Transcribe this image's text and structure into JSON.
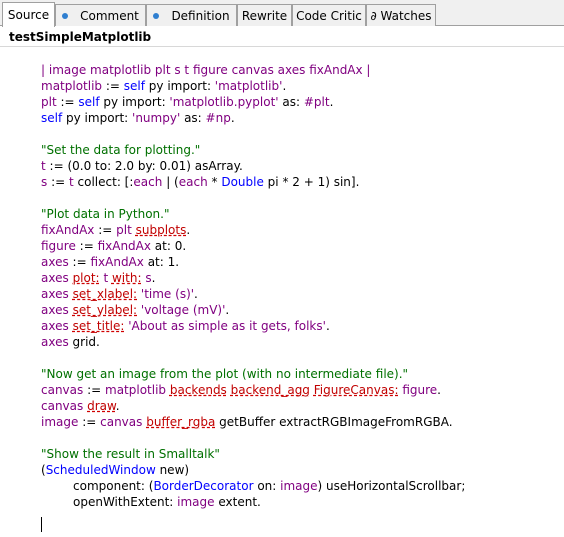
{
  "tabs": [
    {
      "label": "Source",
      "icon": ""
    },
    {
      "label": "Comment",
      "icon": "blue-dot-icon"
    },
    {
      "label": "Definition",
      "icon": "blue-dot-icon"
    },
    {
      "label": "Rewrite",
      "icon": ""
    },
    {
      "label": "Code Critic",
      "icon": ""
    },
    {
      "label": "∂ Watches",
      "icon": ""
    }
  ],
  "method_title": "testSimpleMatplotlib",
  "colors": {
    "temp": "#800080",
    "keyword": "#0000ff",
    "comment": "#007000",
    "inst_var": "#c00000",
    "error_underline": "#d00000",
    "tab_icon": "#2f7fd0"
  },
  "code": {
    "l1": [
      "| image matplotlib plt s t figure canvas axes fixAndAx |"
    ],
    "l2": [
      "matplotlib",
      " := ",
      "self",
      " py import: ",
      "'matplotlib'",
      "."
    ],
    "l3": [
      "plt",
      " := ",
      "self",
      " py import: ",
      "'matplotlib.pyplot'",
      " as: ",
      "#plt",
      "."
    ],
    "l4": [
      "self",
      " py import: ",
      "'numpy'",
      " as: ",
      "#np",
      "."
    ],
    "l6": [
      "\"Set the data for plotting.\""
    ],
    "l7": [
      "t",
      " := (0.0 to: 2.0 by: 0.01) asArray."
    ],
    "l8": [
      "s",
      " := ",
      "t",
      " collect: [:",
      "each",
      " | (",
      "each",
      " * ",
      "Double",
      " pi * 2 + 1) sin]."
    ],
    "l10": [
      "\"Plot data in Python.\""
    ],
    "l11": [
      "fixAndAx",
      " := ",
      "plt",
      " ",
      "subplots",
      "."
    ],
    "l12": [
      "figure",
      " := ",
      "fixAndAx",
      " at: 0."
    ],
    "l13": [
      "axes",
      " := ",
      "fixAndAx",
      " at: 1."
    ],
    "l14": [
      "axes",
      " ",
      "plot:",
      " ",
      "t",
      " ",
      "with:",
      " ",
      "s",
      "."
    ],
    "l15": [
      "axes",
      " ",
      "set_xlabel:",
      " ",
      "'time (s)'",
      "."
    ],
    "l16": [
      "axes",
      " ",
      "set_ylabel:",
      " ",
      "'voltage (mV)'",
      "."
    ],
    "l17": [
      "axes",
      " ",
      "set_title:",
      " ",
      "'About as simple as it gets, folks'",
      "."
    ],
    "l18": [
      "axes",
      " grid."
    ],
    "l20": [
      "\"Now get an image from the plot (with no intermediate file).\""
    ],
    "l21": [
      "canvas",
      " := ",
      "matplotlib",
      " ",
      "backends",
      " ",
      "backend_agg",
      " ",
      "FigureCanvas:",
      " ",
      "figure",
      "."
    ],
    "l22": [
      "canvas",
      " ",
      "draw",
      "."
    ],
    "l23": [
      "image",
      " := ",
      "canvas",
      " ",
      "buffer_rgba",
      " getBuffer extractRGBImageFromRGBA."
    ],
    "l25": [
      "\"Show the result in Smalltalk\""
    ],
    "l26": [
      "(",
      "ScheduledWindow",
      " new)"
    ],
    "l27": [
      "component: (",
      "BorderDecorator",
      " on: ",
      "image",
      ") useHorizontalScrollbar;"
    ],
    "l28": [
      "openWithExtent: ",
      "image",
      " extent."
    ]
  }
}
